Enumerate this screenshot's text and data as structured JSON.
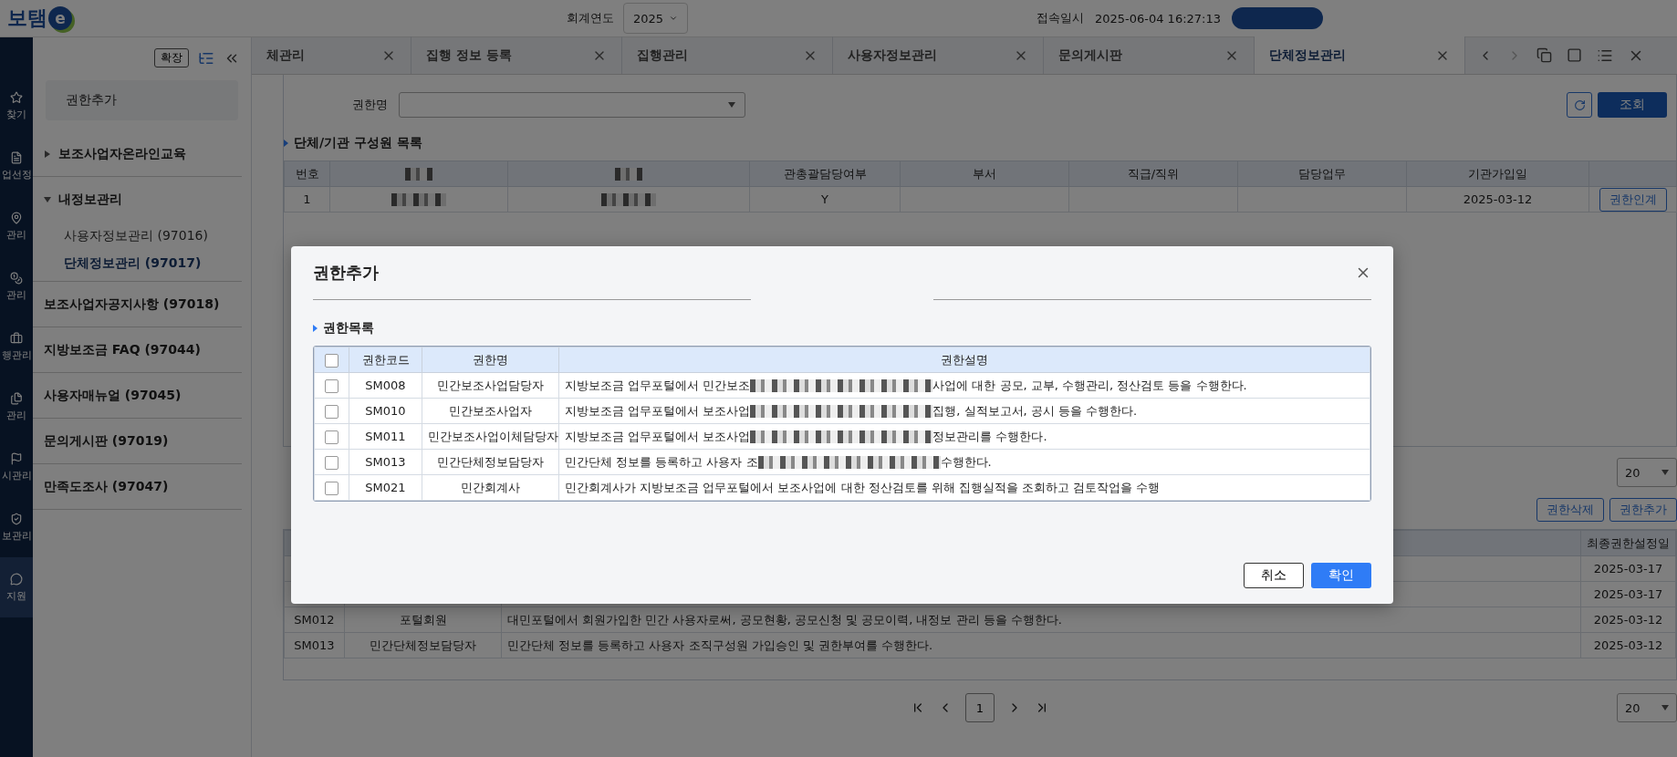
{
  "header": {
    "logo": {
      "text": "보탬",
      "mark": "e"
    },
    "fiscal_year": {
      "label": "회계연도",
      "value": "2025"
    },
    "login_time": {
      "label": "접속일시",
      "value": "2025-06-04 16:27:13"
    }
  },
  "icon_rail": [
    {
      "label": "찾기",
      "kind": "star",
      "selected": false
    },
    {
      "label": "업선정",
      "kind": "doc",
      "selected": false
    },
    {
      "label": "관리",
      "kind": "pin",
      "selected": false
    },
    {
      "label": "관리",
      "kind": "coin",
      "selected": false
    },
    {
      "label": "행관리",
      "kind": "bag",
      "selected": false
    },
    {
      "label": "관리",
      "kind": "copy",
      "selected": false
    },
    {
      "label": "시관리",
      "kind": "flag",
      "selected": false
    },
    {
      "label": "보관리",
      "kind": "check",
      "selected": false
    },
    {
      "label": "지원",
      "kind": "chat",
      "selected": true
    }
  ],
  "sidebar": {
    "expand_button": "확장",
    "search": {
      "value": "권한추가"
    },
    "tree": [
      {
        "label": "보조사업자온라인교육",
        "kind": "group",
        "expanded": false
      },
      {
        "label": "내정보관리",
        "kind": "group",
        "expanded": true,
        "children": [
          {
            "label": "사용자정보관리 (97016)",
            "selected": false
          },
          {
            "label": "단체정보관리 (97017)",
            "selected": true
          }
        ]
      },
      {
        "label": "보조사업자공지사항 (97018)",
        "kind": "link"
      },
      {
        "label": "지방보조금 FAQ (97044)",
        "kind": "link"
      },
      {
        "label": "사용자매뉴얼 (97045)",
        "kind": "link"
      },
      {
        "label": "문의게시판 (97019)",
        "kind": "link"
      },
      {
        "label": "만족도조사 (97047)",
        "kind": "link"
      }
    ]
  },
  "tabs": [
    {
      "label": "체관리",
      "selected": false
    },
    {
      "label": "집행 정보 등록",
      "selected": false
    },
    {
      "label": "집행관리",
      "selected": false
    },
    {
      "label": "사용자정보관리",
      "selected": false
    },
    {
      "label": "문의게시판",
      "selected": false
    },
    {
      "label": "단체정보관리",
      "selected": true
    }
  ],
  "search_form": {
    "label": "권한명",
    "search_button": "조회"
  },
  "members": {
    "title": "단체/기관 구성원 목록",
    "columns": [
      {
        "label": "번호"
      },
      {
        "redacted": true
      },
      {
        "redacted": true
      },
      {
        "label": "관총괄담당여부"
      },
      {
        "label": "부서"
      },
      {
        "label": "직급/직위"
      },
      {
        "label": "담당업무"
      },
      {
        "label": "기관가입일"
      }
    ],
    "rows": [
      {
        "cells": [
          "1",
          null,
          null,
          "Y",
          null,
          null,
          null,
          "2025-03-12"
        ],
        "action": "권한인계"
      }
    ]
  },
  "roles": {
    "page_size": "20",
    "buttons": [
      "권한삭제",
      "권한추가"
    ],
    "last_column": "최종권한설정일",
    "rows": [
      {
        "date": "2025-03-17"
      },
      {
        "date": "2025-03-17"
      },
      {
        "code": "SM012",
        "name": "포털회원",
        "description": "대민포털에서 회원가입한 민간 사용자로써, 공모현황, 공모신청 및 공모이력, 내정보 관리 등을 수행한다.",
        "date": "2025-03-12"
      },
      {
        "code": "SM013",
        "name": "민간단체정보담당자",
        "description": "민간단체 정보를 등록하고 사용자 조직구성원 가입승인 및 권한부여를 수행한다.",
        "date": "2025-03-12"
      }
    ],
    "pagination": {
      "pages": [
        {
          "label": "1",
          "selected": true
        }
      ],
      "page_size": "20"
    }
  },
  "modal": {
    "title": "권한추가",
    "section": "권한목록",
    "header_checked": false,
    "columns": [
      "권한코드",
      "권한명",
      "권한설명"
    ],
    "rows": [
      {
        "checked": false,
        "code": "SM008",
        "name": "민간보조사업담당자",
        "desc_start": "지방보조금 업무포털에서  민간보조",
        "desc_end": "사업에 대한 공모, 교부, 수행관리, 정산검토 등을 수행한다.",
        "redacted": true
      },
      {
        "checked": false,
        "code": "SM010",
        "name": "민간보조사업자",
        "desc_start": "지방보조금 업무포털에서 보조사업",
        "desc_end": "집행, 실적보고서, 공시 등을 수행한다.",
        "redacted": true
      },
      {
        "checked": false,
        "code": "SM011",
        "name": "민간보조사업이체담당자",
        "desc_start": "지방보조금 업무포털에서 보조사업",
        "desc_end": "정보관리를 수행한다.",
        "redacted": true
      },
      {
        "checked": false,
        "code": "SM013",
        "name": "민간단체정보담당자",
        "desc_start": "민간단체 정보를 등록하고 사용자 조",
        "desc_end": "수행한다.",
        "redacted": true
      },
      {
        "checked": false,
        "code": "SM021",
        "name": "민간회계사",
        "desc_start": "민간회계사가 지방보조금 업무포털에서 보조사업에 대한 정산검토를 위해 집행실적을 조회하고 검토작업을 수행",
        "redacted": false
      }
    ],
    "cancel": "취소",
    "confirm": "확인"
  }
}
